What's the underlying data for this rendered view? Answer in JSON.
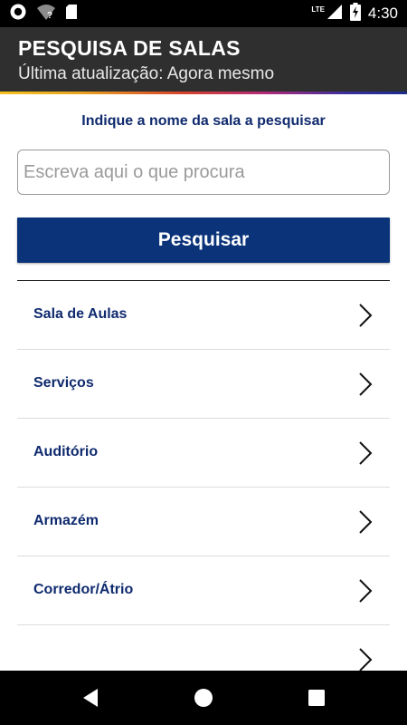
{
  "status_bar": {
    "time": "4:30",
    "network": "LTE",
    "icons": [
      "circle-notification-icon",
      "wifi-unknown-icon",
      "sd-card-icon",
      "cell-signal-icon",
      "battery-charging-icon"
    ]
  },
  "app_bar": {
    "title": "PESQUISA DE SALAS",
    "subtitle": "Última atualização: Agora mesmo"
  },
  "search": {
    "prompt": "Indique a nome da sala a pesquisar",
    "placeholder": "Escreva aqui o que procura",
    "value": "",
    "button_label": "Pesquisar"
  },
  "categories": [
    {
      "label": "Sala de Aulas"
    },
    {
      "label": "Serviços"
    },
    {
      "label": "Auditório"
    },
    {
      "label": "Armazém"
    },
    {
      "label": "Corredor/Átrio"
    },
    {
      "label": ""
    }
  ],
  "colors": {
    "primary": "#0a337a",
    "text_accent": "#0f2a6e",
    "app_bar": "#2f2f2f"
  },
  "nav_bar": {
    "icons": [
      "back-icon",
      "home-icon",
      "recents-icon"
    ]
  }
}
